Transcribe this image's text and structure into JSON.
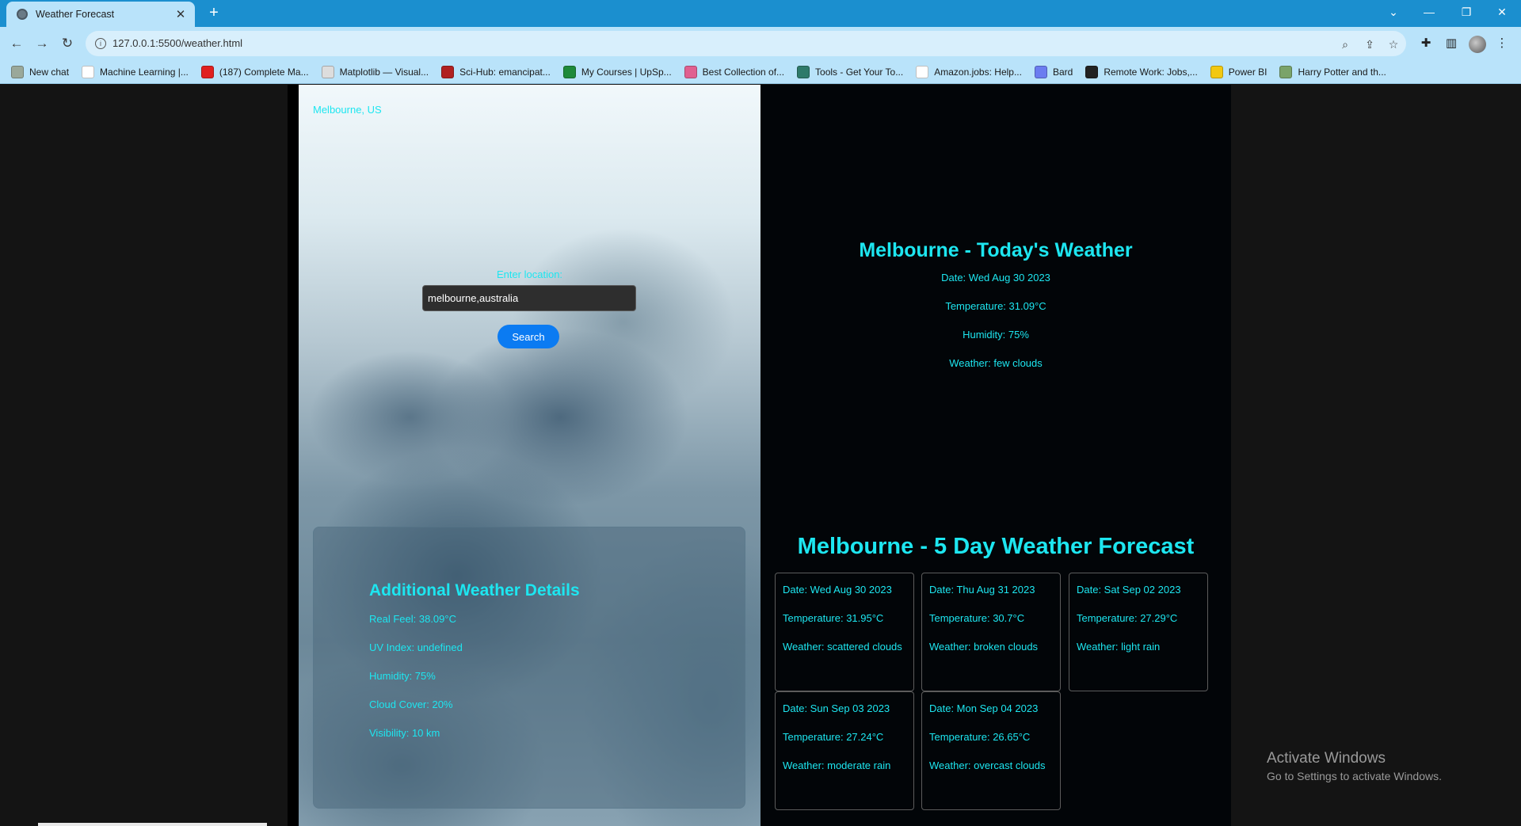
{
  "browser": {
    "tab_title": "Weather Forecast",
    "url": "127.0.0.1:5500/weather.html",
    "bookmarks": [
      {
        "label": "New chat",
        "icon": "chatgpt-icon",
        "color": "#9aa89a"
      },
      {
        "label": "Machine Learning |...",
        "icon": "google-icon",
        "color": "#ffffff"
      },
      {
        "label": "(187) Complete Ma...",
        "icon": "youtube-icon",
        "color": "#e02020"
      },
      {
        "label": "Matplotlib — Visual...",
        "icon": "matplotlib-icon",
        "color": "#dddddd"
      },
      {
        "label": "Sci-Hub: emancipat...",
        "icon": "scihub-icon",
        "color": "#b02020"
      },
      {
        "label": "My Courses | UpSp...",
        "icon": "upspark-icon",
        "color": "#1e8a3a"
      },
      {
        "label": "Best Collection of...",
        "icon": "collection-icon",
        "color": "#e06090"
      },
      {
        "label": "Tools - Get Your To...",
        "icon": "tools-icon",
        "color": "#2e7a6a"
      },
      {
        "label": "Amazon.jobs: Help...",
        "icon": "amazon-icon",
        "color": "#ffffff"
      },
      {
        "label": "Bard",
        "icon": "bard-icon",
        "color": "#6b7cf0"
      },
      {
        "label": "Remote Work: Jobs,...",
        "icon": "remote-icon",
        "color": "#222222"
      },
      {
        "label": "Power BI",
        "icon": "powerbi-icon",
        "color": "#f2c811"
      },
      {
        "label": "Harry Potter and th...",
        "icon": "harrypotter-icon",
        "color": "#7aa36a"
      }
    ]
  },
  "left": {
    "location": "Melbourne, US",
    "search_label": "Enter location:",
    "search_value": "melbourne,australia",
    "search_button": "Search",
    "details": {
      "title": "Additional Weather Details",
      "real_feel": "Real Feel: 38.09°C",
      "uv_index": "UV Index: undefined",
      "humidity": "Humidity: 75%",
      "cloud_cover": "Cloud Cover: 20%",
      "visibility": "Visibility: 10 km"
    }
  },
  "today": {
    "title": "Melbourne - Today's Weather",
    "date": "Date: Wed Aug 30 2023",
    "temperature": "Temperature: 31.09°C",
    "humidity": "Humidity: 75%",
    "weather": "Weather: few clouds"
  },
  "forecast": {
    "title": "Melbourne - 5 Day Weather Forecast",
    "days": [
      {
        "date": "Date: Wed Aug 30 2023",
        "temperature": "Temperature: 31.95°C",
        "weather": "Weather: scattered clouds"
      },
      {
        "date": "Date: Thu Aug 31 2023",
        "temperature": "Temperature: 30.7°C",
        "weather": "Weather: broken clouds"
      },
      {
        "date": "Date: Sat Sep 02 2023",
        "temperature": "Temperature: 27.29°C",
        "weather": "Weather: light rain"
      },
      {
        "date": "Date: Sun Sep 03 2023",
        "temperature": "Temperature: 27.24°C",
        "weather": "Weather: moderate rain"
      },
      {
        "date": "Date: Mon Sep 04 2023",
        "temperature": "Temperature: 26.65°C",
        "weather": "Weather: overcast clouds"
      }
    ]
  },
  "watermark": {
    "line1": "Activate Windows",
    "line2": "Go to Settings to activate Windows."
  },
  "colors": {
    "accent_text": "#1de6f0",
    "button": "#0b7bf2",
    "chrome": "#1b8fcf"
  }
}
